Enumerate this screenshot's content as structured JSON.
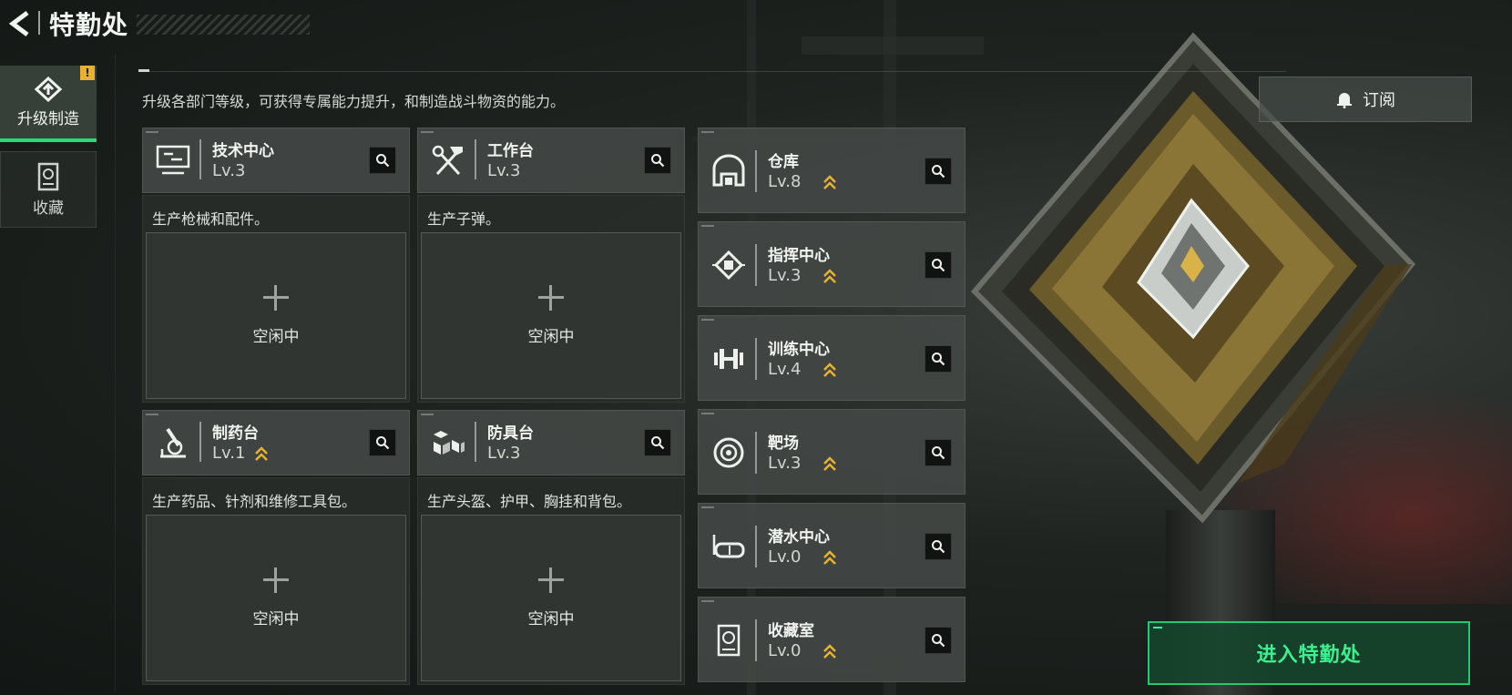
{
  "header": {
    "title": "特勤处",
    "back_icon": "back-arrow-icon"
  },
  "sidebar": {
    "tabs": [
      {
        "label": "升级制造",
        "icon": "upgrade-icon",
        "active": true,
        "alert": "!"
      },
      {
        "label": "收藏",
        "icon": "collection-icon",
        "active": false
      }
    ]
  },
  "description": "升级各部门等级，可获得专属能力提升，和制造战斗物资的能力。",
  "stations": [
    {
      "name": "技术中心",
      "level": "Lv.3",
      "icon": "monitor-icon",
      "upgradable": false,
      "desc": "生产枪械和配件。",
      "slot_status": "空闲中"
    },
    {
      "name": "工作台",
      "level": "Lv.3",
      "icon": "tools-icon",
      "upgradable": false,
      "desc": "生产子弹。",
      "slot_status": "空闲中"
    },
    {
      "name": "制药台",
      "level": "Lv.1",
      "icon": "microscope-icon",
      "upgradable": true,
      "desc": "生产药品、针剂和维修工具包。",
      "slot_status": "空闲中"
    },
    {
      "name": "防具台",
      "level": "Lv.3",
      "icon": "armor-blocks-icon",
      "upgradable": false,
      "desc": "生产头盔、护甲、胸挂和背包。",
      "slot_status": "空闲中"
    }
  ],
  "facilities": [
    {
      "name": "仓库",
      "level": "Lv.8",
      "icon": "warehouse-icon",
      "upgradable": true
    },
    {
      "name": "指挥中心",
      "level": "Lv.3",
      "icon": "chip-icon",
      "upgradable": true
    },
    {
      "name": "训练中心",
      "level": "Lv.4",
      "icon": "dumbbell-icon",
      "upgradable": true
    },
    {
      "name": "靶场",
      "level": "Lv.3",
      "icon": "target-icon",
      "upgradable": true
    },
    {
      "name": "潜水中心",
      "level": "Lv.0",
      "icon": "diving-mask-icon",
      "upgradable": true
    },
    {
      "name": "收藏室",
      "level": "Lv.0",
      "icon": "display-case-icon",
      "upgradable": true
    }
  ],
  "buttons": {
    "subscribe": "订阅",
    "enter": "进入特勤处"
  },
  "colors": {
    "accent_green": "#2bd97c",
    "upgrade_gold": "#e8b230",
    "panel": "#424744"
  }
}
